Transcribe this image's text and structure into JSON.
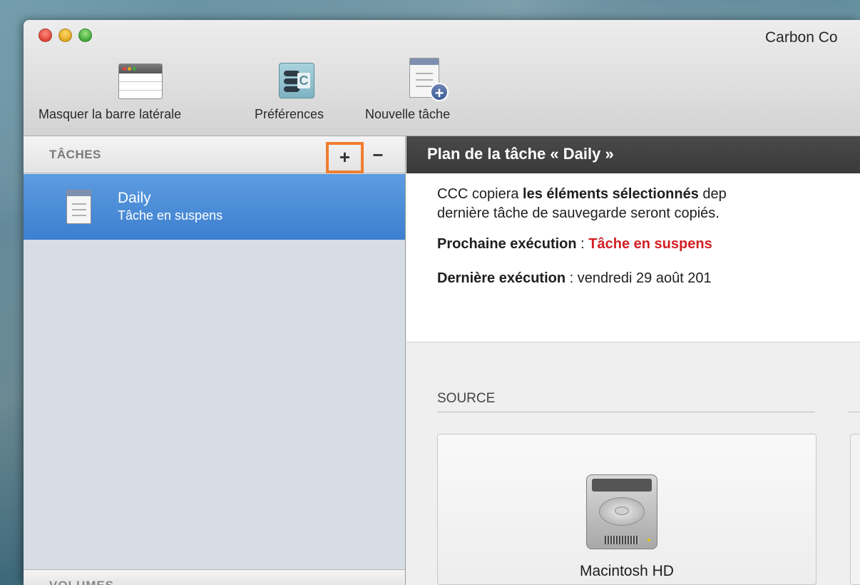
{
  "window": {
    "title": "Carbon Co",
    "close_icon": "close-dot",
    "minimize_icon": "minimize-dot",
    "zoom_icon": "zoom-dot"
  },
  "toolbar": {
    "hide_sidebar_label": "Masquer la barre latérale",
    "preferences_label": "Préférences",
    "new_task_label": "Nouvelle tâche"
  },
  "sidebar": {
    "title": "TÂCHES",
    "add_symbol": "+",
    "remove_symbol": "−",
    "tasks": [
      {
        "name": "Daily",
        "status": "Tâche en suspens"
      }
    ],
    "footer_label": "VOLUMES"
  },
  "main": {
    "header_title": "Plan de la tâche « Daily »",
    "summary": {
      "line1_prefix": "CCC copiera ",
      "line1_bold": "les éléments sélectionnés",
      "line1_suffix": " dep",
      "line2": "dernière tâche de sauvegarde seront copiés.",
      "next_run_label": "Prochaine exécution",
      "next_run_separator": " : ",
      "next_run_value": "Tâche en suspens",
      "last_run_label": "Dernière exécution",
      "last_run_separator": " : ",
      "last_run_value": "vendredi 29 août 201"
    },
    "source": {
      "label": "SOURCE",
      "volume_name": "Macintosh HD"
    }
  },
  "colors": {
    "accent_selection": "#4a8bd8",
    "highlight_box": "#f07d2f",
    "status_red": "#d11f23"
  }
}
